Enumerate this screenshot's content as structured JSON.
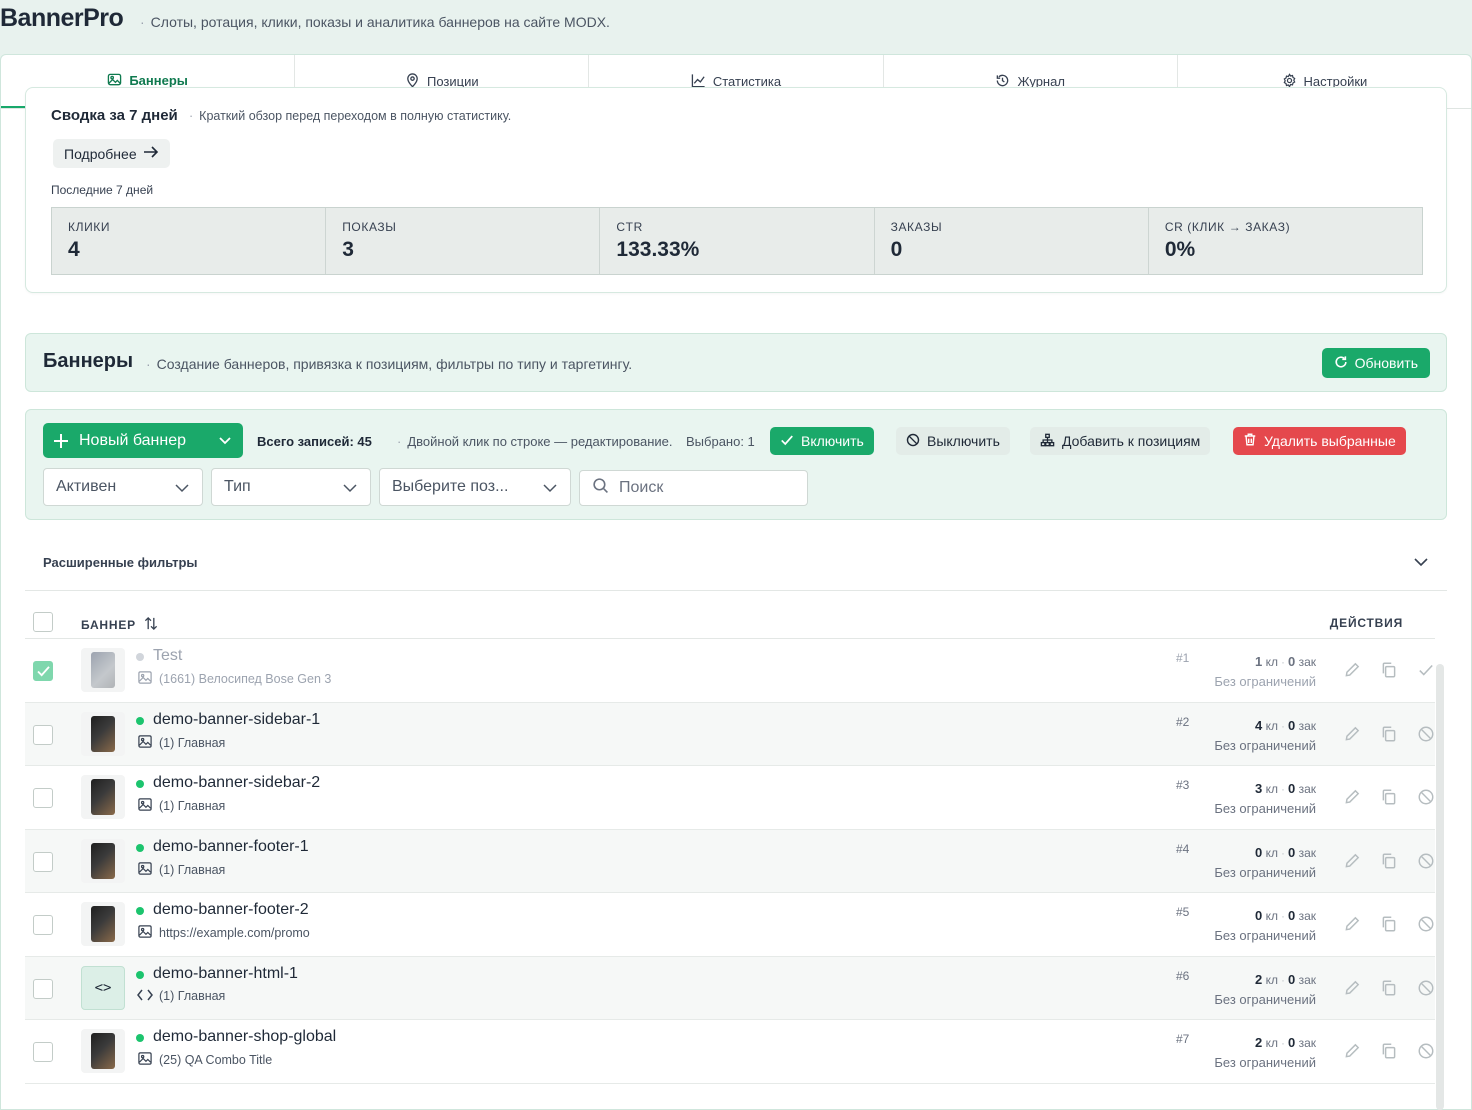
{
  "app": {
    "brand": "BannerPro",
    "subtitle": "Слоты, ротация, клики, показы и аналитика баннеров на сайте MODX."
  },
  "tabs": [
    {
      "label": "Баннеры",
      "icon": "image-icon",
      "active": true
    },
    {
      "label": "Позиции",
      "icon": "map-pin-icon",
      "active": false
    },
    {
      "label": "Статистика",
      "icon": "chart-line-icon",
      "active": false
    },
    {
      "label": "Журнал",
      "icon": "history-icon",
      "active": false
    },
    {
      "label": "Настройки",
      "icon": "gear-icon",
      "active": false
    }
  ],
  "summary": {
    "title": "Сводка за 7 дней",
    "description": "Краткий обзор перед переходом в полную статистику.",
    "more_label": "Подробнее",
    "period_label": "Последние 7 дней",
    "metrics": [
      {
        "label": "КЛИКИ",
        "value": "4"
      },
      {
        "label": "ПОКАЗЫ",
        "value": "3"
      },
      {
        "label": "CTR",
        "value": "133.33%"
      },
      {
        "label": "ЗАКАЗЫ",
        "value": "0"
      },
      {
        "label": "CR (КЛИК → ЗАКАЗ)",
        "value": "0%"
      }
    ]
  },
  "banners_section": {
    "title": "Баннеры",
    "description": "Создание баннеров, привязка к позициям, фильтры по типу и таргетингу.",
    "refresh_label": "Обновить"
  },
  "toolbar": {
    "new_label": "Новый баннер",
    "total_label": "Всего записей: 45",
    "hint": "Двойной клик по строке — редактирование.",
    "selected_label": "Выбрано: 1",
    "enable_label": "Включить",
    "disable_label": "Выключить",
    "add_positions_label": "Добавить к позициям",
    "delete_label": "Удалить выбранные",
    "filter_active": "Активен",
    "filter_type": "Тип",
    "filter_position": "Выберите поз...",
    "search_placeholder": "Поиск"
  },
  "advanced_filters": {
    "label": "Расширенные фильтры"
  },
  "table": {
    "col_banner": "БАННЕР",
    "col_actions": "ДЕЙСТВИЯ",
    "rows": [
      {
        "name": "Test",
        "sub": "(1661) Велосипед Bose Gen 3",
        "sub_icon": "image-icon",
        "num": "#1",
        "clicks": "1",
        "clicks_unit": "кл",
        "orders": "0",
        "orders_unit": "зак",
        "limit": "Без ограничений",
        "active": false,
        "checked": true,
        "thumb": "image"
      },
      {
        "name": "demo-banner-sidebar-1",
        "sub": "(1) Главная",
        "sub_icon": "image-icon",
        "num": "#2",
        "clicks": "4",
        "clicks_unit": "кл",
        "orders": "0",
        "orders_unit": "зак",
        "limit": "Без ограничений",
        "active": true,
        "checked": false,
        "thumb": "image"
      },
      {
        "name": "demo-banner-sidebar-2",
        "sub": "(1) Главная",
        "sub_icon": "image-icon",
        "num": "#3",
        "clicks": "3",
        "clicks_unit": "кл",
        "orders": "0",
        "orders_unit": "зак",
        "limit": "Без ограничений",
        "active": true,
        "checked": false,
        "thumb": "image"
      },
      {
        "name": "demo-banner-footer-1",
        "sub": "(1) Главная",
        "sub_icon": "image-icon",
        "num": "#4",
        "clicks": "0",
        "clicks_unit": "кл",
        "orders": "0",
        "orders_unit": "зак",
        "limit": "Без ограничений",
        "active": true,
        "checked": false,
        "thumb": "image"
      },
      {
        "name": "demo-banner-footer-2",
        "sub": "https://example.com/promo",
        "sub_icon": "image-icon",
        "num": "#5",
        "clicks": "0",
        "clicks_unit": "кл",
        "orders": "0",
        "orders_unit": "зак",
        "limit": "Без ограничений",
        "active": true,
        "checked": false,
        "thumb": "image"
      },
      {
        "name": "demo-banner-html-1",
        "sub": "(1) Главная",
        "sub_icon": "code-icon",
        "num": "#6",
        "clicks": "2",
        "clicks_unit": "кл",
        "orders": "0",
        "orders_unit": "зак",
        "limit": "Без ограничений",
        "active": true,
        "checked": false,
        "thumb": "code"
      },
      {
        "name": "demo-banner-shop-global",
        "sub": "(25) QA Combo Title",
        "sub_icon": "image-icon",
        "num": "#7",
        "clicks": "2",
        "clicks_unit": "кл",
        "orders": "0",
        "orders_unit": "зак",
        "limit": "Без ограничений",
        "active": true,
        "checked": false,
        "thumb": "image"
      }
    ]
  },
  "colors": {
    "accent": "#1aa96a",
    "danger": "#e5484d",
    "panel_bg": "#e9f5f0"
  }
}
